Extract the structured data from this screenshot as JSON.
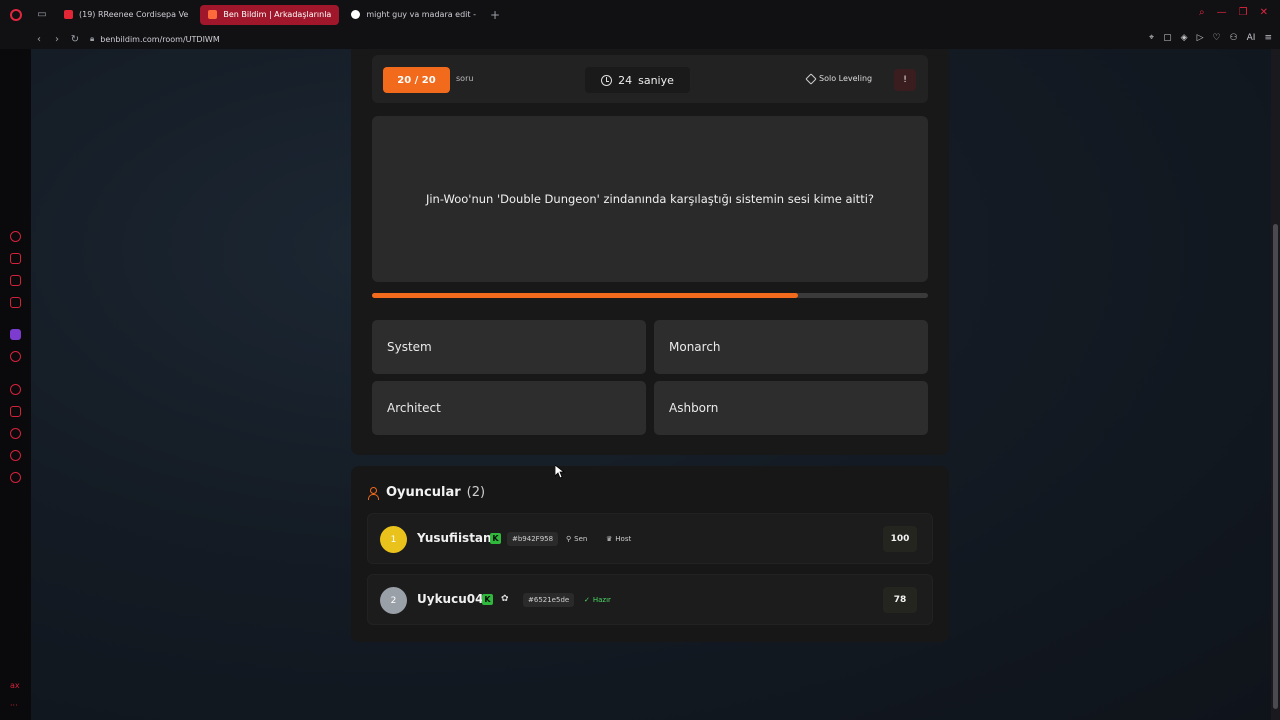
{
  "browser": {
    "tabs": [
      {
        "label": "(19) RReenee Cordisepa Ve",
        "active": false,
        "favicon": "youtube"
      },
      {
        "label": "Ben Bildim | Arkadaşlarınla",
        "active": true,
        "favicon": "benbildim"
      },
      {
        "label": "might guy va madara edit -",
        "active": false,
        "favicon": "google"
      }
    ],
    "add_tab": "+",
    "url": "benbildim.com/room/UTDIWM",
    "ai_label": "AI"
  },
  "game": {
    "question_counter": "20 / 20",
    "question_unit": "soru",
    "timer_value": "24",
    "timer_unit": "saniye",
    "category": "Solo Leveling",
    "report_icon": "!",
    "question": "Jin-Woo'nun 'Double Dungeon' zindanında karşılaştığı sistemin sesi kime aitti?",
    "time_progress": 0.766,
    "answers": [
      "System",
      "Monarch",
      "Architect",
      "Ashborn"
    ]
  },
  "players": {
    "title": "Oyuncular",
    "count": "(2)",
    "list": [
      {
        "rank": "1",
        "name": "Yusufiistan",
        "badge": "K",
        "id": "#b942F958",
        "you_label": "Sen",
        "host_label": "Host",
        "score": "100"
      },
      {
        "rank": "2",
        "name": "Uykucu04",
        "badge": "K",
        "id": "#6521e5de",
        "ready_label": "Hazır",
        "score": "78"
      }
    ]
  },
  "colors": {
    "accent": "#f26a1b",
    "browser_accent": "#e3263f",
    "ready": "#4cd964",
    "gold": "#eac21c"
  }
}
